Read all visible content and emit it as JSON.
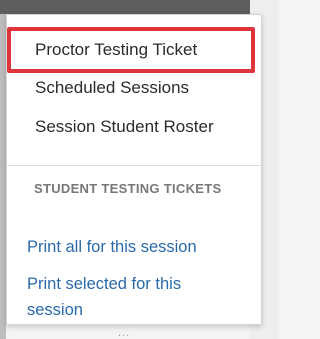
{
  "background": {
    "peek_text": "..."
  },
  "menu": {
    "items": [
      {
        "label": "Proctor Testing Ticket",
        "highlighted": true
      },
      {
        "label": "Scheduled Sessions"
      },
      {
        "label": "Session Student Roster"
      }
    ],
    "section_header": "STUDENT TESTING TICKETS",
    "links": [
      {
        "label": "Print all for this session"
      },
      {
        "label": "Print selected for this session"
      }
    ]
  },
  "colors": {
    "highlight_border": "#e1353d",
    "link": "#2a6aaa",
    "header": "#777777",
    "text": "#2b2b2b"
  }
}
